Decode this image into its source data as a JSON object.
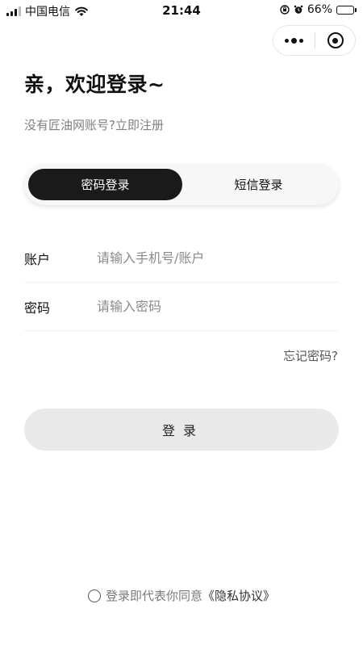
{
  "status_bar": {
    "carrier": "中国电信",
    "time": "21:44",
    "battery": "66%",
    "battery_level": 0.66
  },
  "capsule": {
    "more_icon": "more-dots-icon",
    "close_icon": "target-circle-icon"
  },
  "header": {
    "title": "亲，欢迎登录~",
    "register_prompt": "没有匠油网账号?",
    "register_link": "立即注册"
  },
  "tabs": [
    {
      "label": "密码登录",
      "active": true
    },
    {
      "label": "短信登录",
      "active": false
    }
  ],
  "form": {
    "account": {
      "label": "账户",
      "placeholder": "请输入手机号/账户",
      "value": ""
    },
    "password": {
      "label": "密码",
      "placeholder": "请输入密码",
      "value": ""
    },
    "forgot": "忘记密码?"
  },
  "login_button": "登录",
  "agreement": {
    "text": "登录即代表你同意",
    "link": "《隐私协议》"
  },
  "colors": {
    "active_tab_bg": "#1a1a1a",
    "button_bg": "#e9e9e9",
    "muted_text": "#808080"
  }
}
